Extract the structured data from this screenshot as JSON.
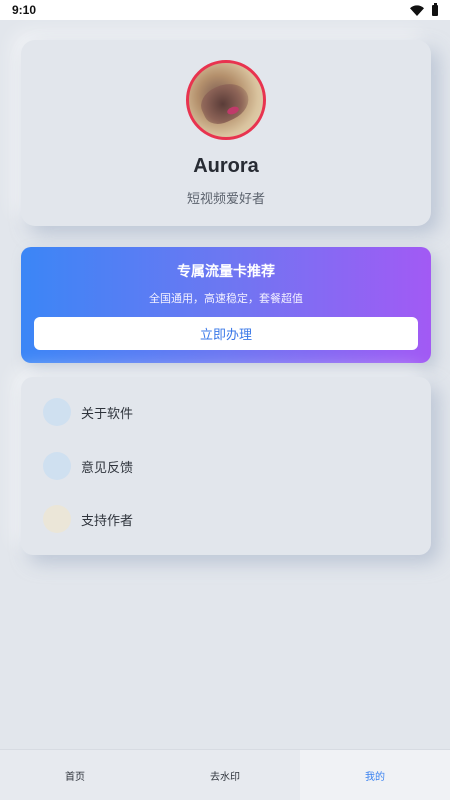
{
  "status_bar": {
    "time": "9:10",
    "icons": [
      "wifi-icon",
      "battery-icon"
    ]
  },
  "profile": {
    "name": "Aurora",
    "bio": "短视频爱好者",
    "avatar_border_color": "#e8334f"
  },
  "promo": {
    "title": "专属流量卡推荐",
    "subtitle": "全国通用，高速稳定，套餐超值",
    "button_label": "立即办理",
    "gradient": [
      "#3b86f6",
      "#a25af4"
    ]
  },
  "menu": {
    "items": [
      {
        "label": "关于软件",
        "icon": "about-icon",
        "color": "#cfe0f0"
      },
      {
        "label": "意见反馈",
        "icon": "feedback-icon",
        "color": "#cfe0f0"
      },
      {
        "label": "支持作者",
        "icon": "support-icon",
        "color": "#ebe6d8"
      }
    ]
  },
  "bottom_nav": {
    "tabs": [
      {
        "label": "首页",
        "active": false
      },
      {
        "label": "去水印",
        "active": false
      },
      {
        "label": "我的",
        "active": true
      }
    ],
    "active_color": "#3a82f0"
  }
}
